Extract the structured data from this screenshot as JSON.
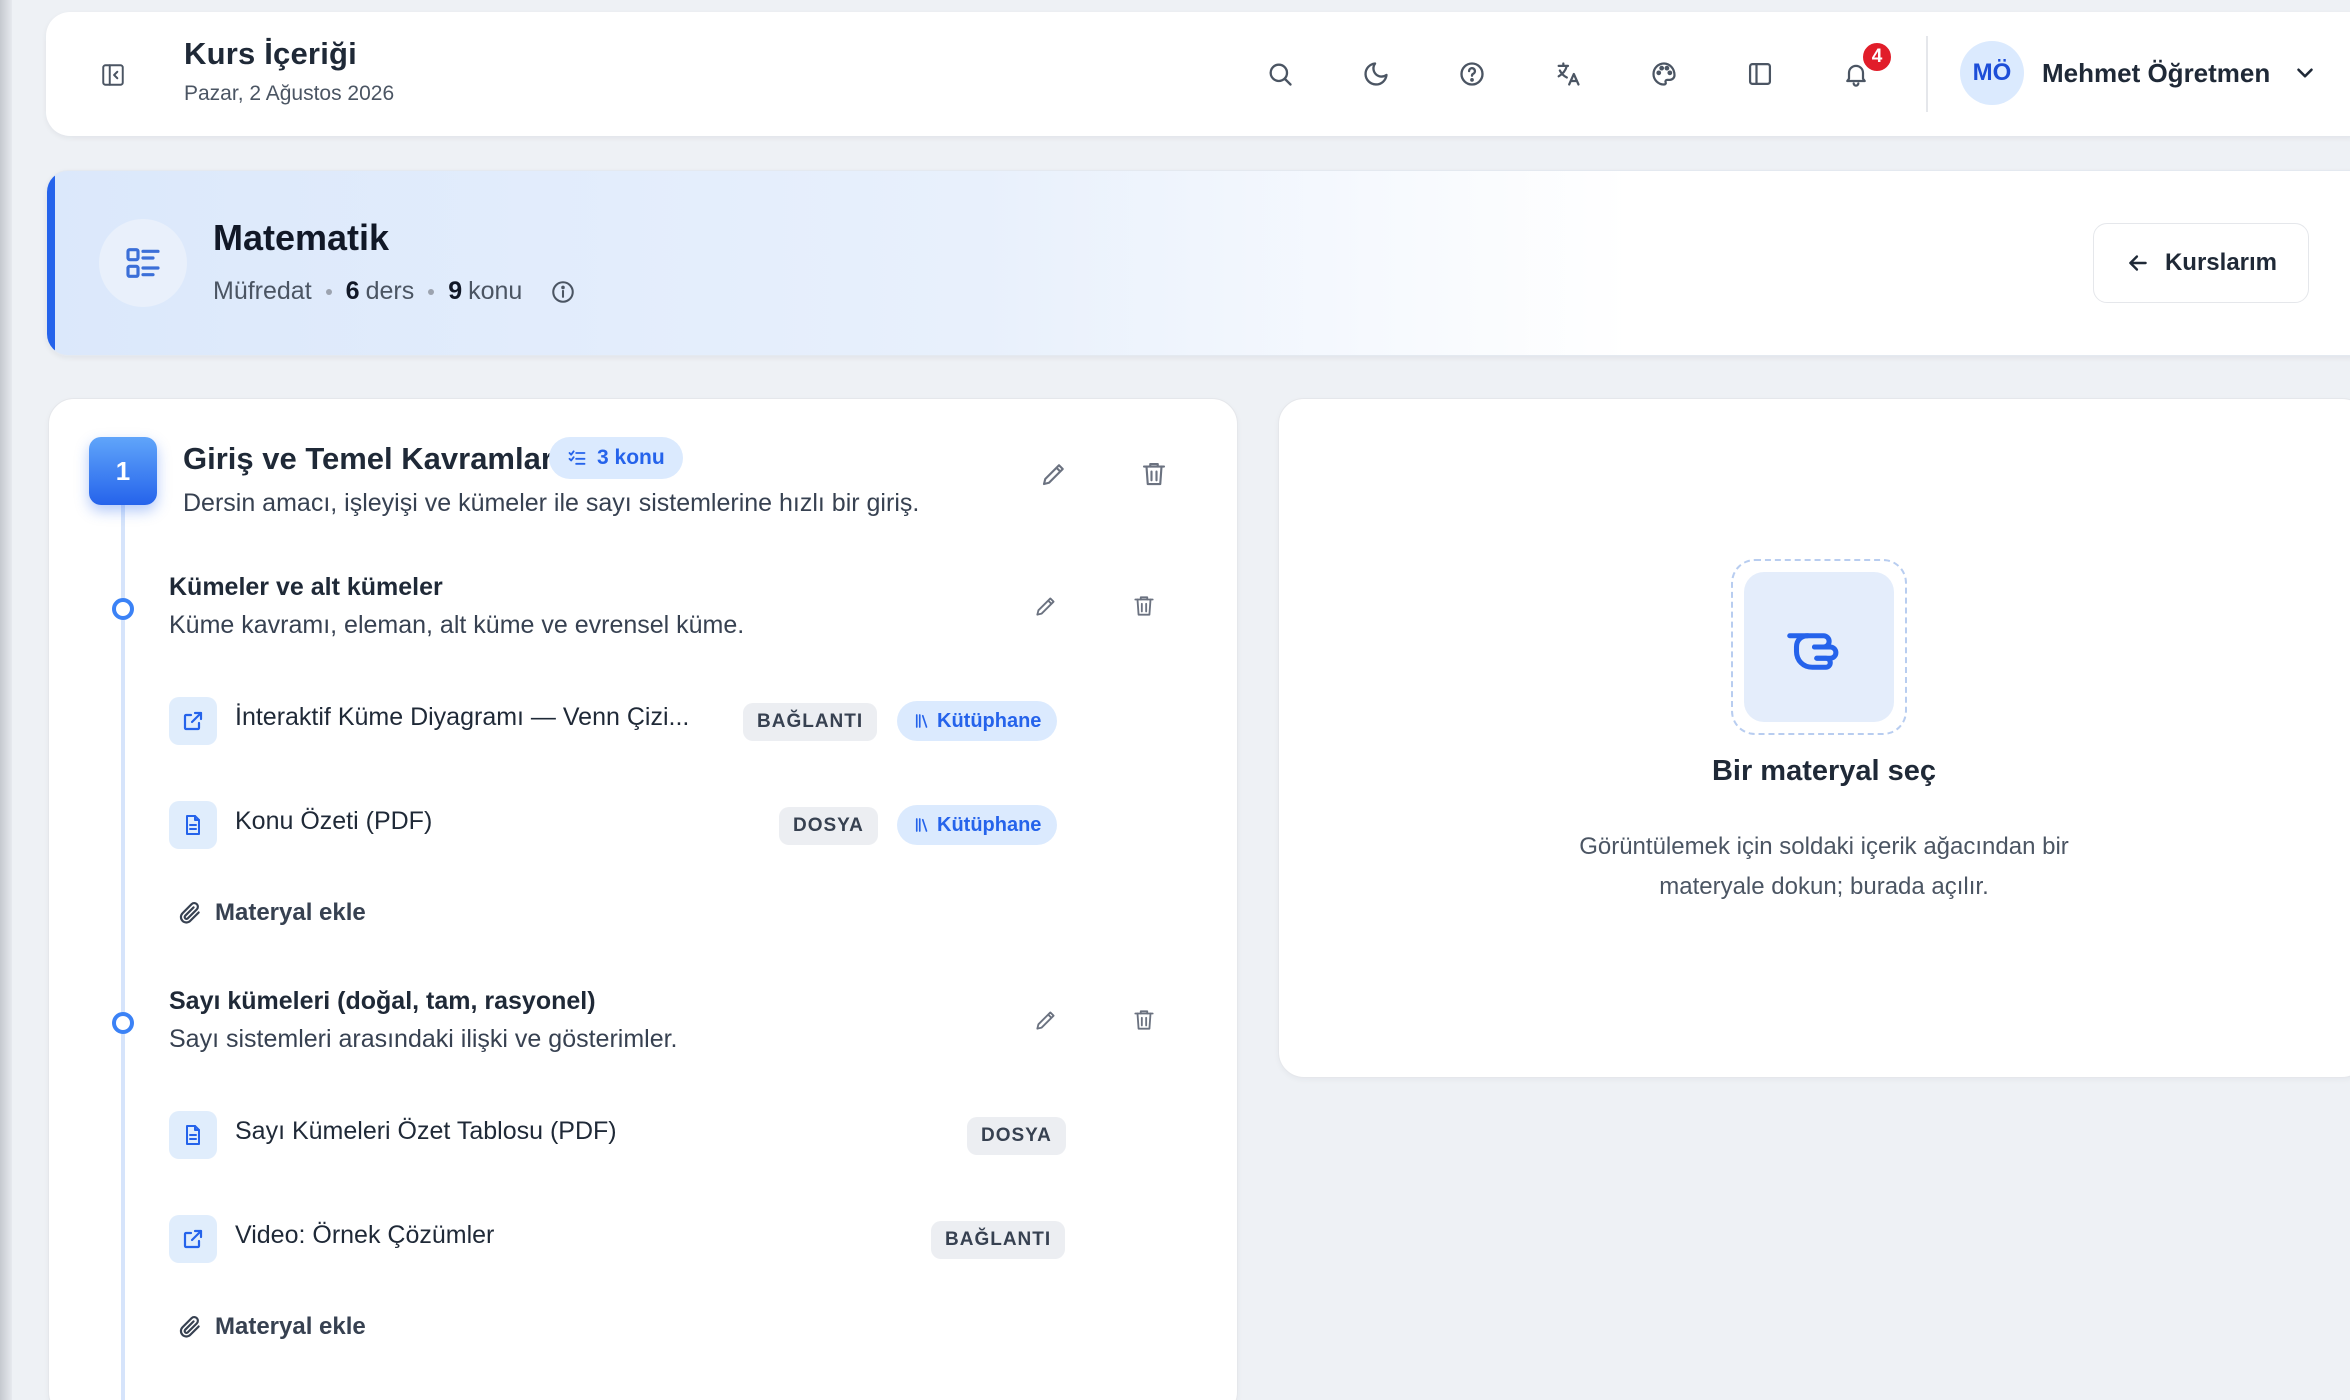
{
  "header": {
    "title": "Kurs İçeriği",
    "date": "Pazar, 2 Ağustos 2026",
    "notification_count": "4",
    "user": {
      "initials": "MÖ",
      "name": "Mehmet Öğretmen"
    }
  },
  "course": {
    "name": "Matematik",
    "meta_label": "Müfredat",
    "lesson_count": "6",
    "lesson_unit": "ders",
    "topic_count": "9",
    "topic_unit": "konu",
    "back_label": "Kurslarım"
  },
  "unit": {
    "number": "1",
    "title": "Giriş ve Temel Kavramlar",
    "topic_badge": "3 konu",
    "description": "Dersin amacı, işleyişi ve kümeler ile sayı sistemlerine hızlı bir giriş."
  },
  "topics": [
    {
      "title": "Kümeler ve alt kümeler",
      "description": "Küme kavramı, eleman, alt küme ve evrensel küme.",
      "materials": [
        {
          "title": "İnteraktif Küme Diyagramı — Venn Çizi...",
          "type": "BAĞLANTI",
          "library": "Kütüphane",
          "icon": "external-link-icon"
        },
        {
          "title": "Konu Özeti (PDF)",
          "type": "DOSYA",
          "library": "Kütüphane",
          "icon": "document-icon"
        }
      ],
      "add_label": "Materyal ekle"
    },
    {
      "title": "Sayı kümeleri (doğal, tam, rasyonel)",
      "description": "Sayı sistemleri arasındaki ilişki ve gösterimler.",
      "materials": [
        {
          "title": "Sayı Kümeleri Özet Tablosu (PDF)",
          "type": "DOSYA",
          "icon": "document-icon"
        },
        {
          "title": "Video: Örnek Çözümler",
          "type": "BAĞLANTI",
          "icon": "external-link-icon"
        }
      ],
      "add_label": "Materyal ekle"
    }
  ],
  "preview": {
    "title": "Bir materyal seç",
    "description": "Görüntülemek için soldaki içerik ağacından bir materyale dokun; burada açılır."
  },
  "colors": {
    "accent": "#2563eb",
    "badge": "#e11d2a",
    "tag_bg": "#eceef2",
    "library_bg": "#dbeafe"
  }
}
